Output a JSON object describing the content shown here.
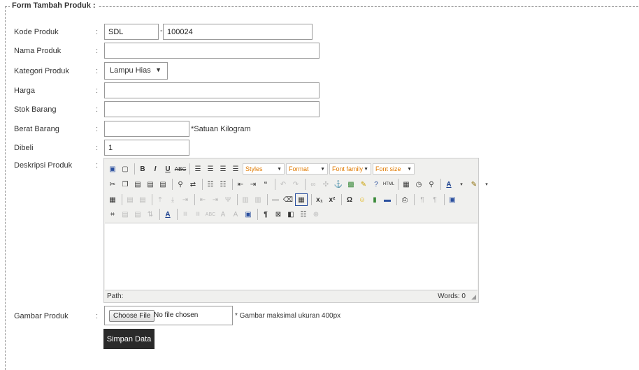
{
  "form": {
    "legend": "Form Tambah Produk :",
    "colon": ":",
    "fields": {
      "kode": {
        "label": "Kode Produk",
        "prefix": "SDL",
        "dash": "-",
        "number": "100024"
      },
      "nama": {
        "label": "Nama Produk",
        "value": ""
      },
      "kategori": {
        "label": "Kategori Produk",
        "selected": "Lampu Hias",
        "caret": "▼"
      },
      "harga": {
        "label": "Harga",
        "value": ""
      },
      "stok": {
        "label": "Stok Barang",
        "value": ""
      },
      "berat": {
        "label": "Berat Barang",
        "value": "",
        "note": "*Satuan Kilogram"
      },
      "dibeli": {
        "label": "Dibeli",
        "value": "1"
      },
      "deskripsi": {
        "label": "Deskripsi Produk"
      },
      "gambar": {
        "label": "Gambar Produk",
        "button": "Choose File",
        "status": "No file chosen",
        "note": "* Gambar maksimal ukuran 400px"
      }
    },
    "editor": {
      "styles": "Styles",
      "format": "Format",
      "font_family": "Font family",
      "font_size": "Font size",
      "path": "Path:",
      "words": "Words: 0"
    },
    "submit": "Simpan Data"
  }
}
